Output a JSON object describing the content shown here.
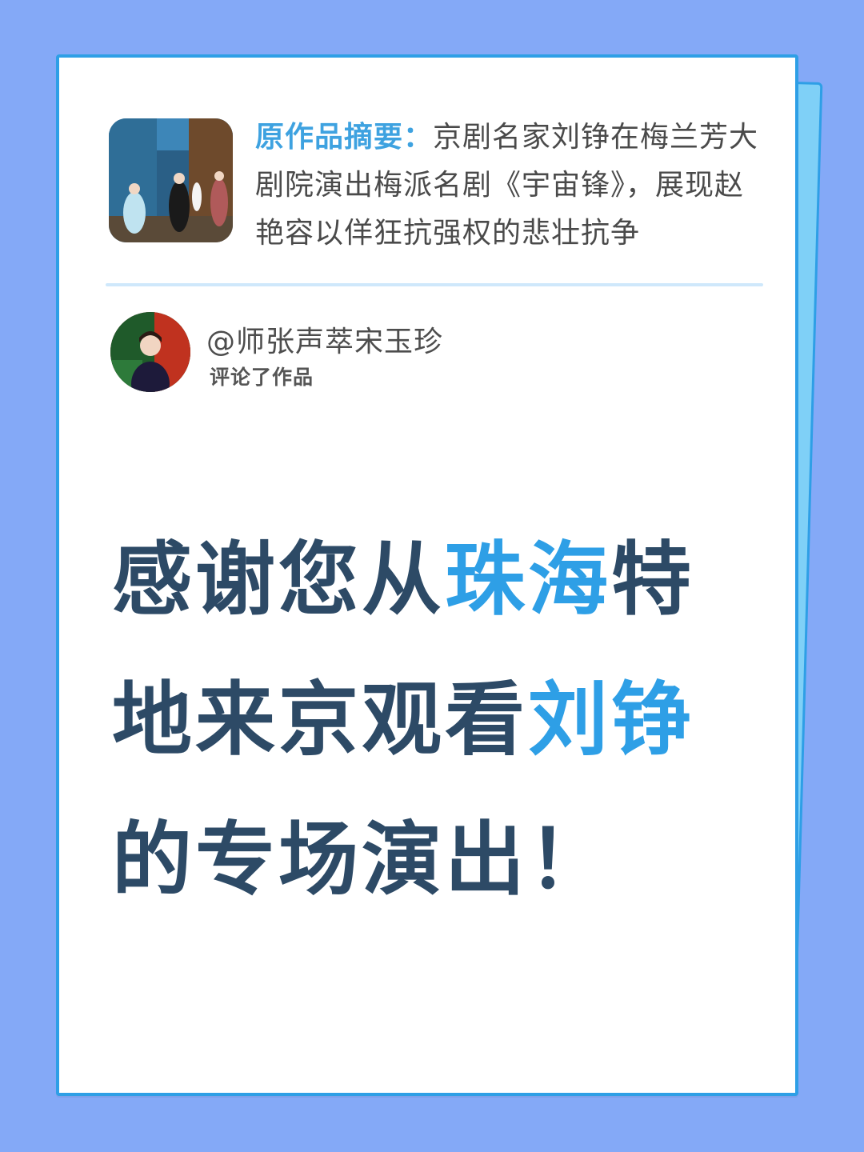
{
  "summary": {
    "label": "原作品摘要：",
    "text": "京剧名家刘铮在梅兰芳大剧院演出梅派名剧《宇宙锋》，展现赵艳容以佯狂抗强权的悲壮抗争"
  },
  "comment": {
    "username": "@师张声萃宋玉珍",
    "action": "评论了作品"
  },
  "headline": {
    "part1": "感谢您从",
    "highlight1": "珠海",
    "part2": "特地来京观看",
    "highlight2": "刘铮",
    "part3": "的专场演出！"
  },
  "colors": {
    "background": "#84a9f7",
    "accent": "#2e9fe6",
    "headline": "#2d4a66"
  }
}
